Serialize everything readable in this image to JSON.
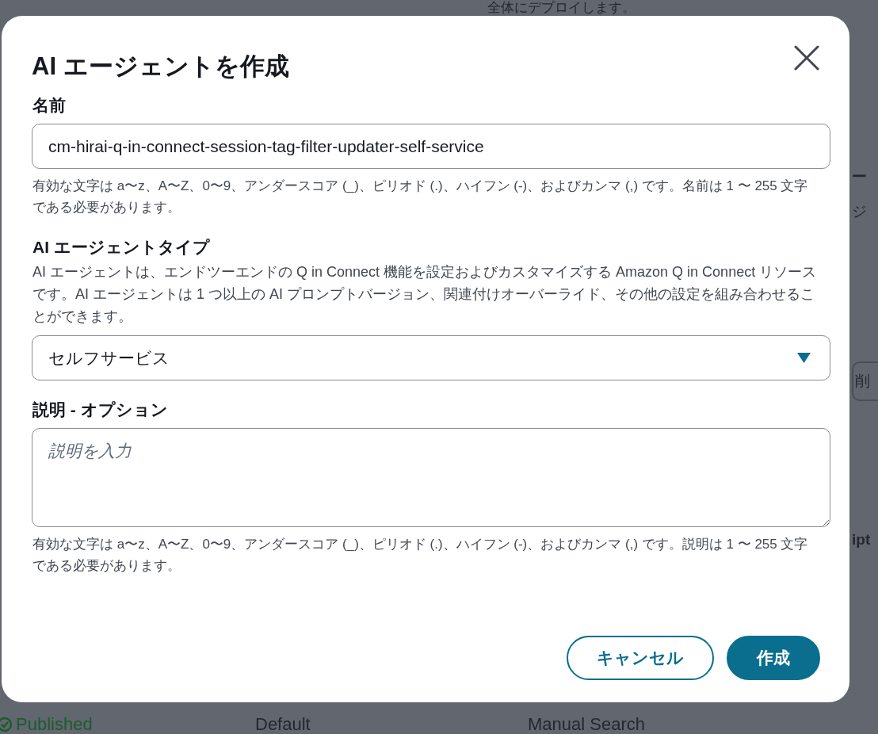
{
  "background": {
    "top_text": "全体にデプロイします。",
    "right_fragments": [
      {
        "kind": "heading",
        "text": "ー"
      },
      {
        "kind": "text",
        "text": "ジ"
      },
      {
        "kind": "button",
        "text": "削"
      },
      {
        "kind": "heading",
        "text": "ipt"
      }
    ],
    "status_row": {
      "status": "Published",
      "column_2": "Default",
      "column_3": "Manual Search"
    }
  },
  "dialog": {
    "title": "AI エージェントを作成",
    "fields": [
      {
        "kind": "input",
        "label": "名前",
        "value": "cm-hirai-q-in-connect-session-tag-filter-updater-self-service",
        "hint": "有効な文字は a〜z、A〜Z、0〜9、アンダースコア (_)、ピリオド (.)、ハイフン (-)、およびカンマ (,) です。名前は 1 〜 255 文字である必要があります。"
      },
      {
        "kind": "select",
        "label": "AI エージェントタイプ",
        "description": "AI エージェントは、エンドツーエンドの Q in Connect 機能を設定およびカスタマイズする Amazon Q in Connect リソースです。AI エージェントは 1 つ以上の AI プロンプトバージョン、関連付けオーバーライド、その他の設定を組み合わせることができます。",
        "value": "セルフサービス"
      },
      {
        "kind": "textarea",
        "label": "説明 - オプション",
        "placeholder": "説明を入力",
        "hint": "有効な文字は a〜z、A〜Z、0〜9、アンダースコア (_)、ピリオド (.)、ハイフン (-)、およびカンマ (,) です。説明は 1 〜 255 文字である必要があります。"
      }
    ],
    "buttons": [
      {
        "kind": "secondary",
        "label": "キャンセル"
      },
      {
        "kind": "primary",
        "label": "作成"
      }
    ]
  }
}
